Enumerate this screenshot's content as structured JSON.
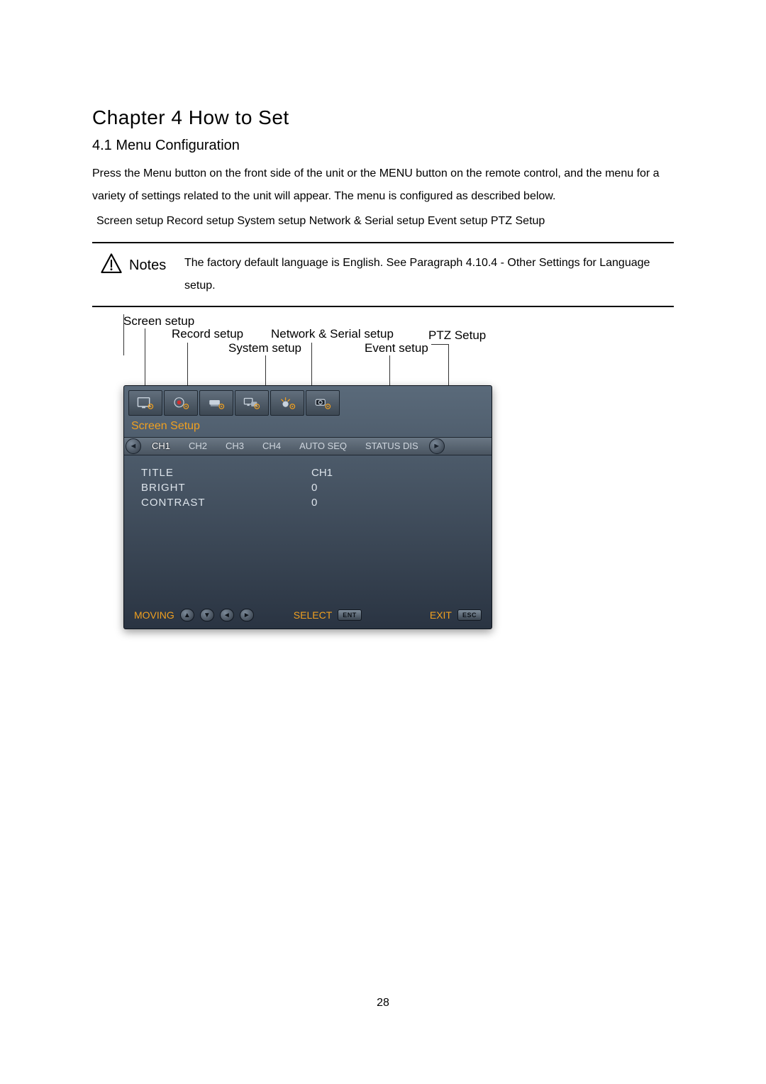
{
  "chapter_title": "Chapter 4   How to Set",
  "section_title": "4.1 Menu Configuration",
  "body_para": "Press the Menu button on the front side of the unit or the MENU button on the remote control, and the menu for a variety of settings related to the unit will appear. The menu is configured as described below.",
  "setup_list_line": " Screen setup Record setup System setup Network & Serial setup Event setup PTZ Setup",
  "notes": {
    "label": "Notes",
    "text": "The factory default language is English. See Paragraph 4.10.4 - Other Settings for Language setup."
  },
  "callouts": {
    "screen": "Screen setup",
    "record": "Record setup",
    "system": "System setup",
    "network": "Network & Serial setup",
    "event": "Event setup",
    "ptz": "PTZ Setup"
  },
  "device": {
    "screen_title": "Screen Setup",
    "tabs": [
      "CH1",
      "CH2",
      "CH3",
      "CH4",
      "AUTO SEQ",
      "STATUS DIS"
    ],
    "rows": [
      {
        "label": "TITLE",
        "value": "CH1"
      },
      {
        "label": "BRIGHT",
        "value": "0"
      },
      {
        "label": "CONTRAST",
        "value": "0"
      }
    ],
    "footer": {
      "moving": "MOVING",
      "select": "SELECT",
      "ent": "ENT",
      "exit": "EXIT",
      "esc": "ESC"
    }
  },
  "page_number": "28"
}
